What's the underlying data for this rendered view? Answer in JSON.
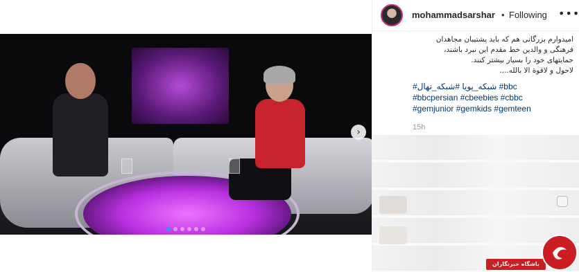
{
  "post": {
    "username": "mohammadsarshar",
    "separator": "•",
    "follow_status": "Following",
    "more_label": "•••",
    "caption_lines": [
      "امیدوارم بزرگانی هم که باید پشتیبان مجاهدان",
      "فرهنگی و والدین خط مقدم این نبرد باشند،",
      "حمایتهای خود را بسیار بیشتر کنند.",
      "لاحول و لاقوة الا بالله...."
    ],
    "hashtag_lines": [
      "#شبکه_پویا #شبکه_نهال #bbc",
      "#bbcpersian #cbeebies #cbbc",
      "#gemjunior #gemkids #gemteen"
    ],
    "time_ago": "15h"
  },
  "carousel": {
    "next_icon": "chevron-right-icon",
    "next_glyph": "›",
    "dot_count": 6,
    "active_dot": 0
  },
  "watermark": {
    "text": "باشگاه خبرنگاران",
    "color": "#c91e23"
  },
  "colors": {
    "hashtag": "#003569",
    "active_dot": "#3897f0"
  }
}
